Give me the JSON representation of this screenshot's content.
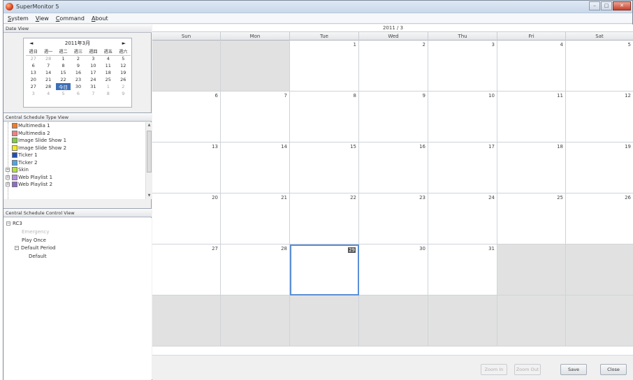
{
  "window": {
    "title": "SuperMonitor 5",
    "controls": [
      "–",
      "□",
      "✕"
    ]
  },
  "menu": [
    "System",
    "View",
    "Command",
    "About"
  ],
  "date_view": {
    "header": "Date View",
    "mini_calendar": {
      "prev": "◄",
      "next": "►",
      "month_label": "2011年3月",
      "weekday_headers": [
        "週日",
        "週一",
        "週二",
        "週三",
        "週四",
        "週五",
        "週六"
      ],
      "weeks": [
        [
          "27",
          "28",
          "1",
          "2",
          "3",
          "4",
          "5"
        ],
        [
          "6",
          "7",
          "8",
          "9",
          "10",
          "11",
          "12"
        ],
        [
          "13",
          "14",
          "15",
          "16",
          "17",
          "18",
          "19"
        ],
        [
          "20",
          "21",
          "22",
          "23",
          "24",
          "25",
          "26"
        ],
        [
          "27",
          "28",
          "今日",
          "30",
          "31",
          "1",
          "2"
        ],
        [
          "3",
          "4",
          "5",
          "6",
          "7",
          "8",
          "9"
        ]
      ],
      "other_month": [
        [
          0,
          0
        ],
        [
          0,
          1
        ],
        [
          4,
          5
        ],
        [
          4,
          6
        ],
        [
          5,
          0
        ],
        [
          5,
          1
        ],
        [
          5,
          2
        ],
        [
          5,
          3
        ],
        [
          5,
          4
        ],
        [
          5,
          5
        ],
        [
          5,
          6
        ]
      ],
      "today": [
        4,
        2
      ]
    }
  },
  "schedule_types": {
    "header": "Central Schedule Type View",
    "items": [
      {
        "label": "Multimedia 1",
        "color": "#f07c28",
        "expandable": false
      },
      {
        "label": "Multimedia 2",
        "color": "#f08080",
        "expandable": false
      },
      {
        "label": "Image Slide Show 1",
        "color": "#7ccf3c",
        "expandable": false
      },
      {
        "label": "Image Slide Show 2",
        "color": "#f2ec1e",
        "expandable": false
      },
      {
        "label": "Ticker 1",
        "color": "#1e4fb8",
        "expandable": false
      },
      {
        "label": "Ticker 2",
        "color": "#4aa6e6",
        "expandable": false
      },
      {
        "label": "Skin",
        "color": "#b3e23a",
        "expandable": true
      },
      {
        "label": "Web Playlist 1",
        "color": "#b58ee0",
        "expandable": true
      },
      {
        "label": "Web Playlist 2",
        "color": "#8e6cc8",
        "expandable": true
      }
    ]
  },
  "schedule_control": {
    "header": "Central Schedule Control View",
    "root": "RC3",
    "children": [
      {
        "label": "Emergency",
        "disabled": true
      },
      {
        "label": "Play Once",
        "disabled": false
      },
      {
        "label": "Default Period",
        "disabled": false
      }
    ],
    "grandchild": "Default"
  },
  "calendar": {
    "title": "2011 / 3",
    "days": [
      "Sun",
      "Mon",
      "Tue",
      "Wed",
      "Thu",
      "Fri",
      "Sat"
    ],
    "weeks": [
      [
        "",
        "",
        "1",
        "2",
        "3",
        "4",
        "5"
      ],
      [
        "6",
        "7",
        "8",
        "9",
        "10",
        "11",
        "12"
      ],
      [
        "13",
        "14",
        "15",
        "16",
        "17",
        "18",
        "19"
      ],
      [
        "20",
        "21",
        "22",
        "23",
        "24",
        "25",
        "26"
      ],
      [
        "27",
        "28",
        "29",
        "30",
        "31",
        "",
        ""
      ],
      [
        "",
        "",
        "",
        "",
        "",
        "",
        ""
      ]
    ],
    "selected_day": "29"
  },
  "buttons": {
    "zoom_in": "Zoom In",
    "zoom_out": "Zoom Out",
    "save": "Save",
    "close": "Close"
  }
}
